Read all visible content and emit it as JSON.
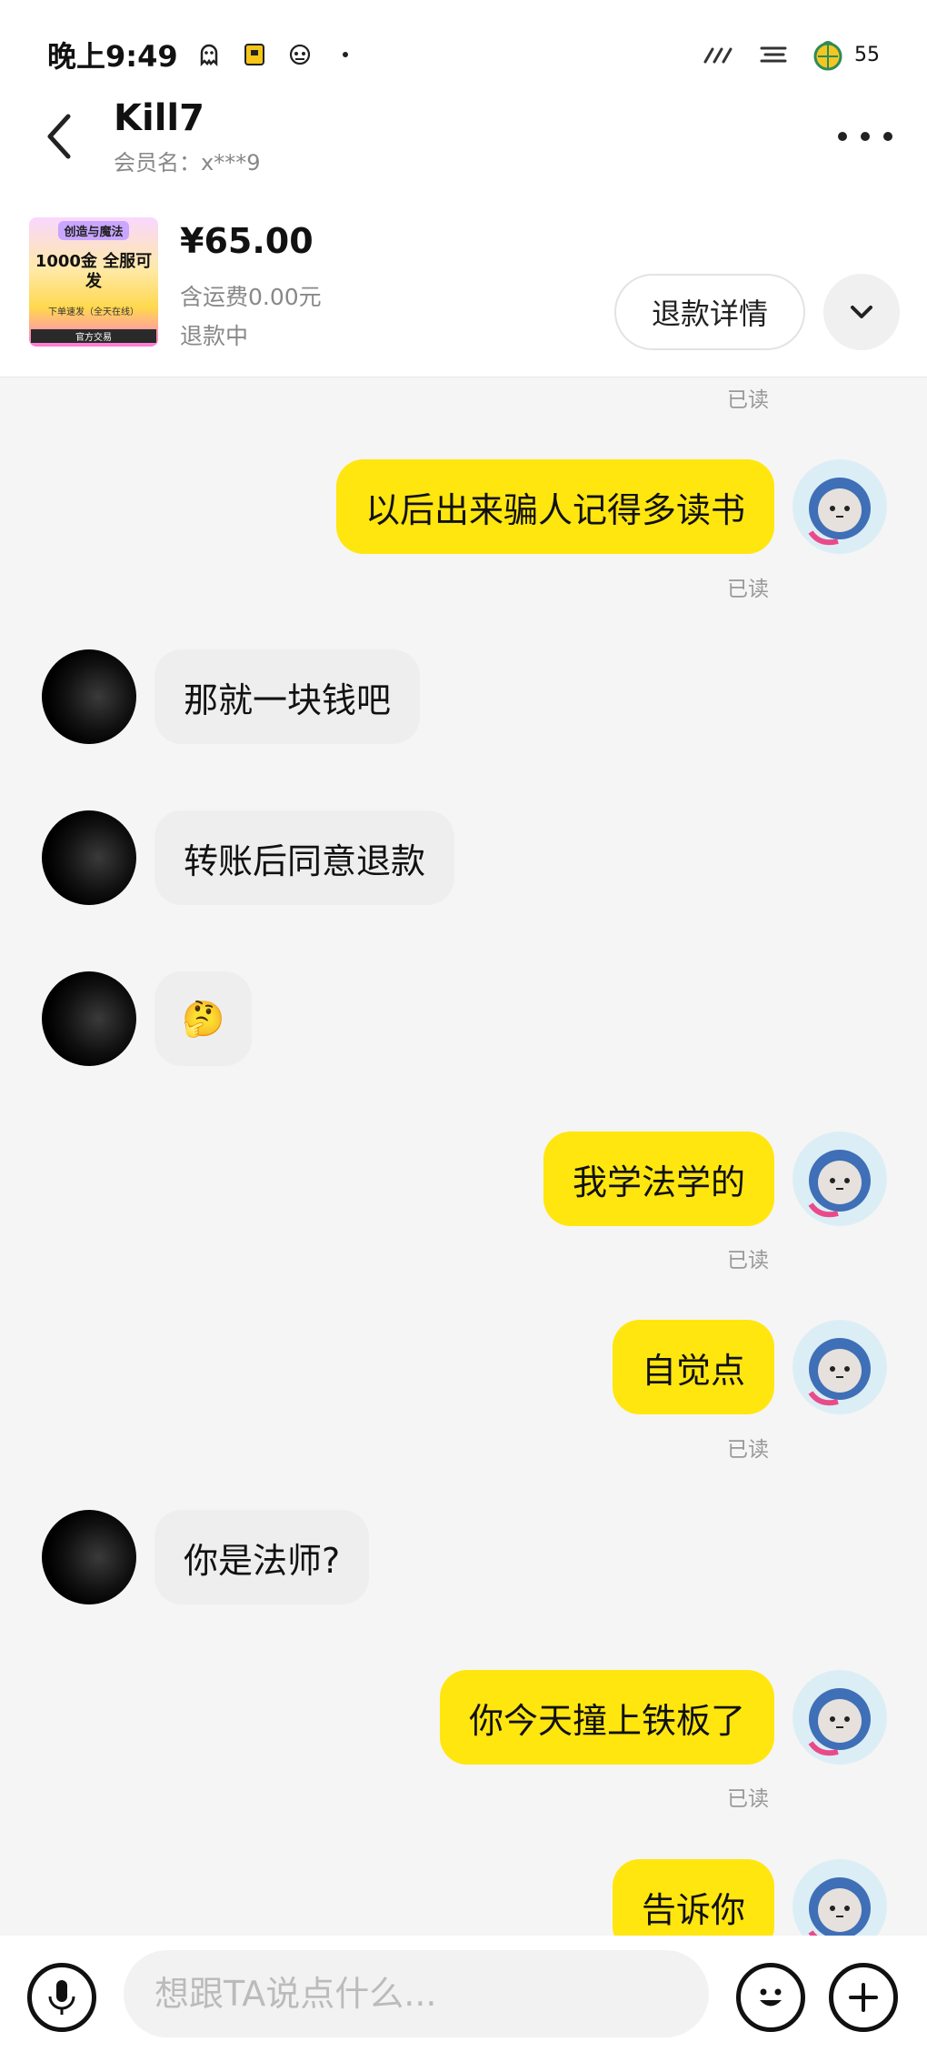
{
  "status_bar": {
    "time": "晚上9:49",
    "battery": "55",
    "icons": [
      "ghost-icon",
      "package-icon",
      "robot-icon",
      "dot-icon",
      "signal-slash-icon",
      "menu-lines-icon",
      "battery-icon"
    ]
  },
  "header": {
    "title": "Kill7",
    "member": "会员名：x***9"
  },
  "product": {
    "thumb_tag": "创造与魔法",
    "thumb_main": "1000金 全服可发",
    "thumb_sub": "下单速发（全天在线）",
    "thumb_strip": "官方交易",
    "price": "¥65.00",
    "shipping": "含运费0.00元",
    "status": "退款中",
    "refund_button": "退款详情"
  },
  "messages": [
    {
      "from": "me",
      "text": "以后出来骗人记得多读书",
      "read": "已读"
    },
    {
      "from": "them",
      "text": "那就一块钱吧"
    },
    {
      "from": "them",
      "text": "转账后同意退款"
    },
    {
      "from": "them",
      "text": "🤔"
    },
    {
      "from": "me",
      "text": "我学法学的",
      "read": "已读"
    },
    {
      "from": "me",
      "text": "自觉点",
      "read": "已读"
    },
    {
      "from": "them",
      "text": "你是法师?"
    },
    {
      "from": "me",
      "text": "你今天撞上铁板了",
      "read": "已读"
    },
    {
      "from": "me",
      "text": "告诉你"
    }
  ],
  "top_read": "已读",
  "input": {
    "placeholder": "想跟TA说点什么..."
  },
  "colors": {
    "my_bubble": "#ffe60f",
    "their_bubble": "#eeeeee"
  }
}
